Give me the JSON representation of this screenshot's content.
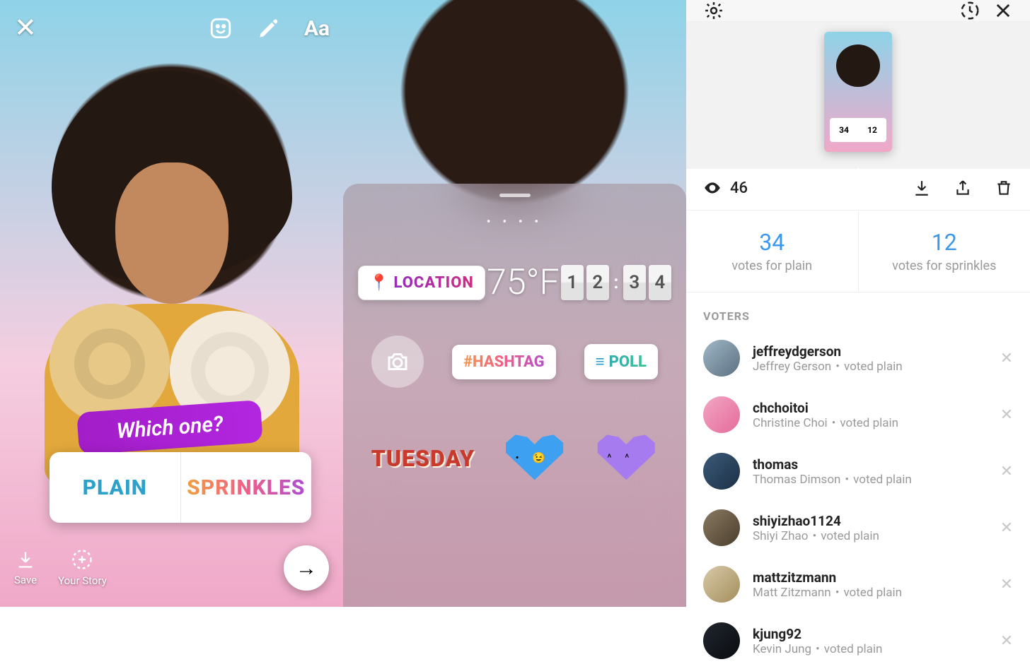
{
  "panel1": {
    "question": "Which one?",
    "options": {
      "left": "PLAIN",
      "right": "SPRINKLES"
    },
    "bottom": {
      "save": "Save",
      "your_story": "Your Story"
    }
  },
  "panel2": {
    "location_label": "LOCATION",
    "temperature": "75°F",
    "clock": [
      "1",
      "2",
      "3",
      "4"
    ],
    "hashtag_label": "#HASHTAG",
    "poll_label": "POLL",
    "day_label": "TUESDAY"
  },
  "panel3": {
    "views": "46",
    "thumb": {
      "left": "34",
      "right": "12"
    },
    "summary": [
      {
        "count": "34",
        "label": "votes for plain"
      },
      {
        "count": "12",
        "label": "votes for sprinkles"
      }
    ],
    "voters_header": "VOTERS",
    "voters": [
      {
        "username": "jeffreydgerson",
        "fullname": "Jeffrey Gerson",
        "vote": "voted plain"
      },
      {
        "username": "chchoitoi",
        "fullname": "Christine Choi",
        "vote": "voted plain"
      },
      {
        "username": "thomas",
        "fullname": "Thomas Dimson",
        "vote": "voted plain"
      },
      {
        "username": "shiyizhao1124",
        "fullname": "Shiyi Zhao",
        "vote": "voted plain"
      },
      {
        "username": "mattzitzmann",
        "fullname": "Matt Zitzmann",
        "vote": "voted plain"
      },
      {
        "username": "kjung92",
        "fullname": "Kevin Jung",
        "vote": "voted plain"
      }
    ]
  }
}
